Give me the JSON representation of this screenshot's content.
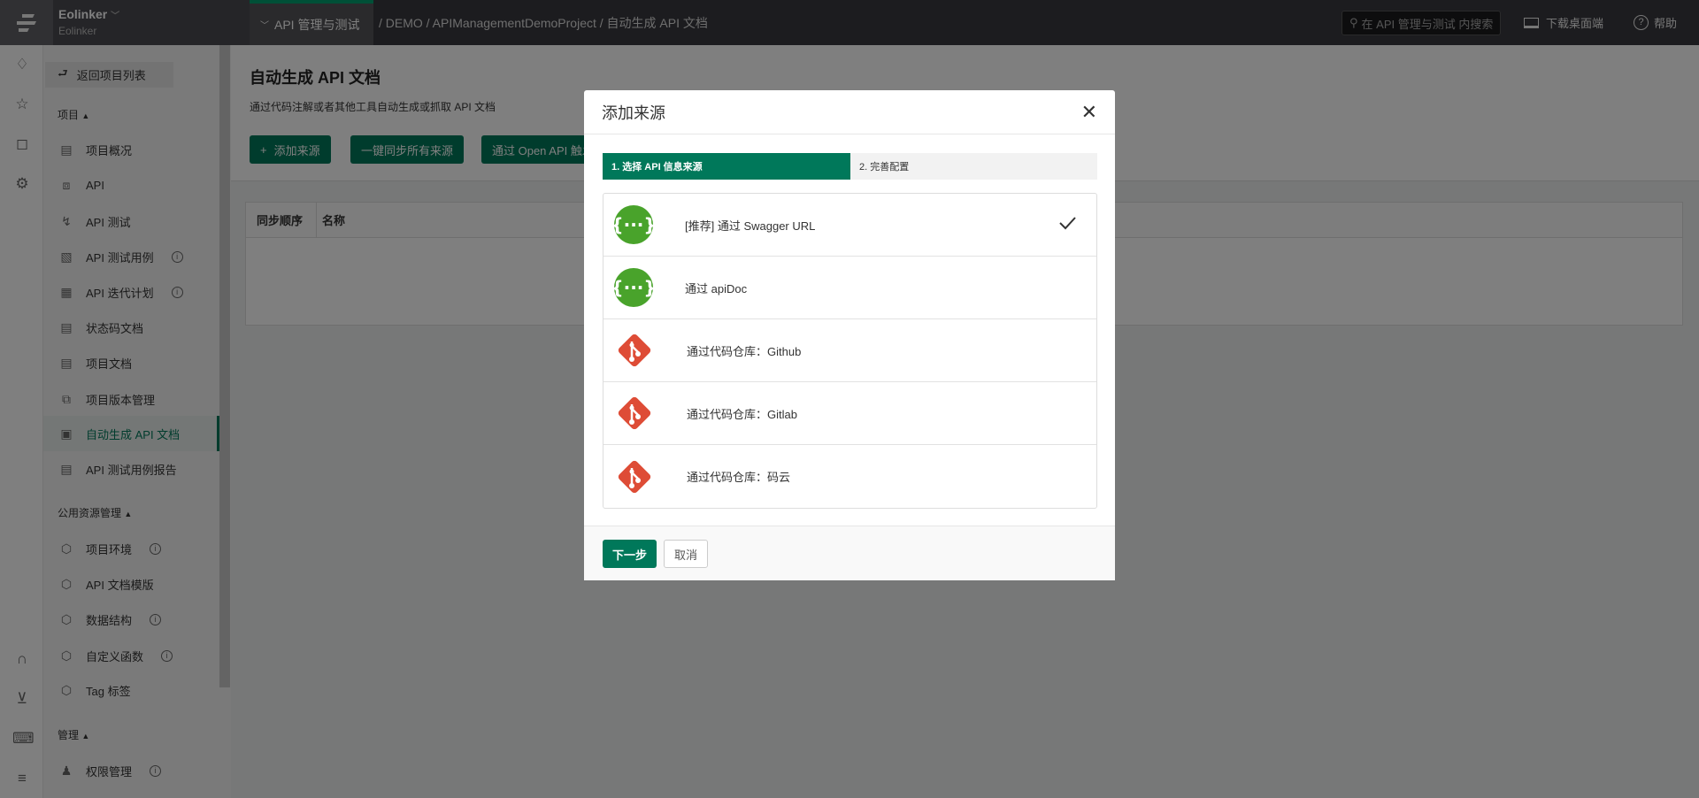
{
  "topbar": {
    "brand": "Eolinker",
    "brand_sub": "Eolinker",
    "app_tab": "API 管理与测试",
    "breadcrumb": "/ DEMO / APIManagementDemoProject / 自动生成 API 文档",
    "search_placeholder": "在 API 管理与测试 内搜索",
    "download": "下载桌面端",
    "help": "帮助"
  },
  "sidebar": {
    "back": "返回项目列表",
    "groups": [
      {
        "title": "项目",
        "items": [
          {
            "label": "项目概况",
            "icon": "overview-icon"
          },
          {
            "label": "API",
            "icon": "api-icon"
          },
          {
            "label": "API 测试",
            "icon": "lightning-icon"
          },
          {
            "label": "API 测试用例",
            "icon": "clipboard-icon",
            "info": true
          },
          {
            "label": "API 迭代计划",
            "icon": "calendar-icon",
            "info": true
          },
          {
            "label": "状态码文档",
            "icon": "doc-icon"
          },
          {
            "label": "项目文档",
            "icon": "doc-list-icon"
          },
          {
            "label": "项目版本管理",
            "icon": "copy-icon"
          },
          {
            "label": "自动生成 API 文档",
            "icon": "robot-icon",
            "active": true
          },
          {
            "label": "API 测试用例报告",
            "icon": "report-icon"
          }
        ]
      },
      {
        "title": "公用资源管理",
        "items": [
          {
            "label": "项目环境",
            "icon": "cube-icon",
            "info": true
          },
          {
            "label": "API 文档模版",
            "icon": "cube-icon"
          },
          {
            "label": "数据结构",
            "icon": "cube-icon",
            "info": true
          },
          {
            "label": "自定义函数",
            "icon": "cube-icon",
            "info": true
          },
          {
            "label": "Tag 标签",
            "icon": "cube-icon"
          }
        ]
      },
      {
        "title": "管理",
        "items": [
          {
            "label": "权限管理",
            "icon": "user-icon",
            "info": true
          }
        ]
      }
    ]
  },
  "content": {
    "title": "自动生成 API 文档",
    "desc": "通过代码注解或者其他工具自动生成或抓取 API 文档",
    "buttons": [
      "添加来源",
      "一键同步所有来源",
      "通过 Open API 触发"
    ],
    "table_headers": [
      "同步顺序",
      "名称"
    ]
  },
  "modal": {
    "title": "添加来源",
    "steps": [
      "1. 选择 API 信息来源",
      "2. 完善配置"
    ],
    "sources": [
      {
        "label": "[推荐] 通过 Swagger URL",
        "icon": "swagger-icon",
        "selected": true
      },
      {
        "label": "通过 apiDoc",
        "icon": "swagger-icon"
      },
      {
        "label": "通过代码仓库：Github",
        "icon": "git-icon"
      },
      {
        "label": "通过代码仓库：Gitlab",
        "icon": "git-icon"
      },
      {
        "label": "通过代码仓库：码云",
        "icon": "git-icon"
      }
    ],
    "next": "下一步",
    "cancel": "取消"
  },
  "colors": {
    "accent": "#00785a",
    "swagger": "#49a32b",
    "git": "#de4c36"
  }
}
